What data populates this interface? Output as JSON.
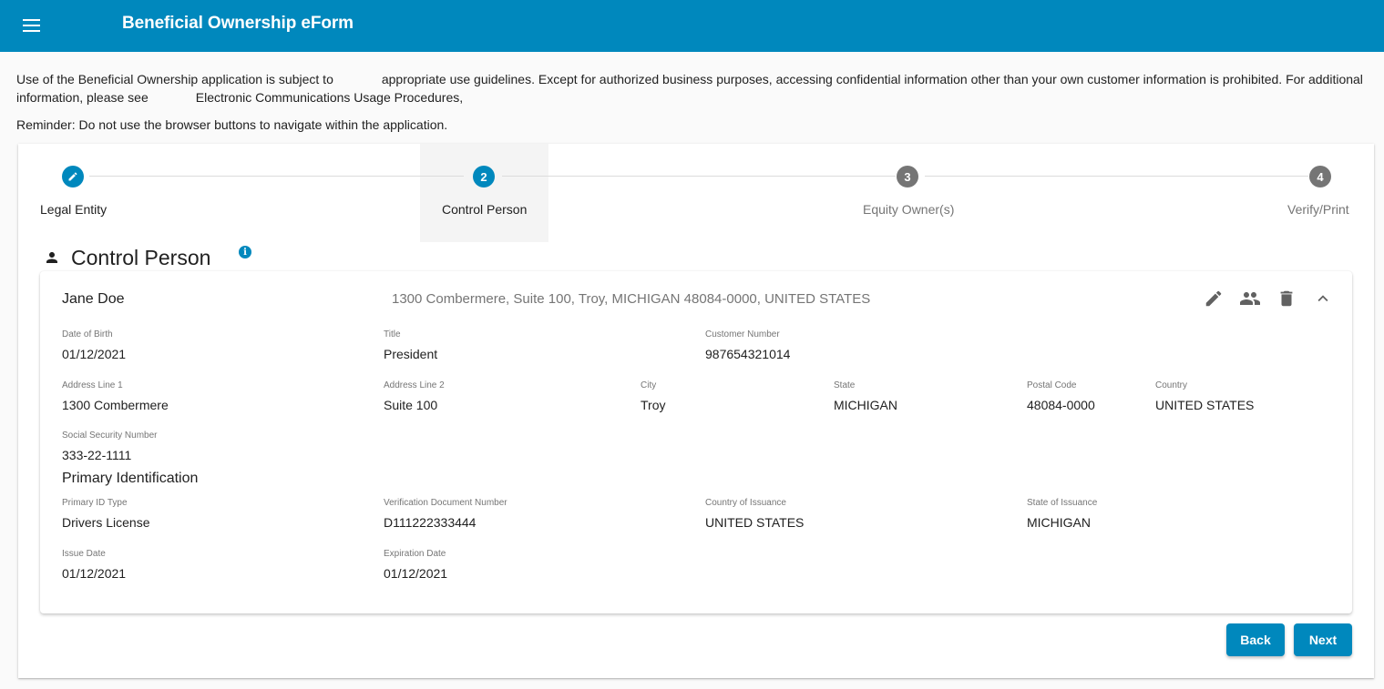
{
  "header": {
    "title": "Beneficial Ownership eForm",
    "menu_icon": "menu-icon"
  },
  "notice": {
    "part1": "Use of the Beneficial Ownership application is subject to",
    "part2": "appropriate use guidelines. Except for authorized business purposes, accessing confidential information other than your own customer information is prohibited. For additional information, please see",
    "part3": "Electronic Communications Usage Procedures,",
    "reminder": "Reminder: Do not use the browser buttons to navigate within the application."
  },
  "stepper": {
    "steps": [
      {
        "label": "Legal Entity",
        "marker": "",
        "icon": "edit-icon",
        "state": "done"
      },
      {
        "label": "Control Person",
        "marker": "2",
        "state": "active"
      },
      {
        "label": "Equity Owner(s)",
        "marker": "3",
        "state": "pending"
      },
      {
        "label": "Verify/Print",
        "marker": "4",
        "state": "pending"
      }
    ]
  },
  "section": {
    "title": "Control Person",
    "icon": "person-icon",
    "info_icon": "info-icon"
  },
  "card": {
    "name": "Jane Doe",
    "address_summary": "1300 Combermere, Suite 100, Troy, MICHIGAN 48084-0000, UNITED STATES",
    "actions": [
      "edit-icon",
      "people-icon",
      "delete-icon",
      "chevron-up-icon"
    ],
    "fields": {
      "dob": {
        "label": "Date of Birth",
        "value": "01/12/2021"
      },
      "title": {
        "label": "Title",
        "value": "President"
      },
      "customer_number": {
        "label": "Customer Number",
        "value": "987654321014"
      },
      "address1": {
        "label": "Address Line 1",
        "value": "1300 Combermere"
      },
      "address2": {
        "label": "Address Line 2",
        "value": "Suite 100"
      },
      "city": {
        "label": "City",
        "value": "Troy"
      },
      "state": {
        "label": "State",
        "value": "MICHIGAN"
      },
      "postal": {
        "label": "Postal Code",
        "value": "48084-0000"
      },
      "country": {
        "label": "Country",
        "value": "UNITED STATES"
      },
      "ssn": {
        "label": "Social Security Number",
        "value": "333-22-1111"
      }
    },
    "primary_id": {
      "heading": "Primary Identification",
      "id_type": {
        "label": "Primary ID Type",
        "value": "Drivers License"
      },
      "doc_number": {
        "label": "Verification Document Number",
        "value": "D111222333444"
      },
      "country_issuance": {
        "label": "Country of Issuance",
        "value": "UNITED STATES"
      },
      "state_issuance": {
        "label": "State of Issuance",
        "value": "MICHIGAN"
      },
      "issue_date": {
        "label": "Issue Date",
        "value": "01/12/2021"
      },
      "expiration_date": {
        "label": "Expiration Date",
        "value": "01/12/2021"
      }
    }
  },
  "buttons": {
    "back": "Back",
    "next": "Next"
  },
  "colors": {
    "brand": "#0088bd",
    "step_pending": "#757575"
  }
}
